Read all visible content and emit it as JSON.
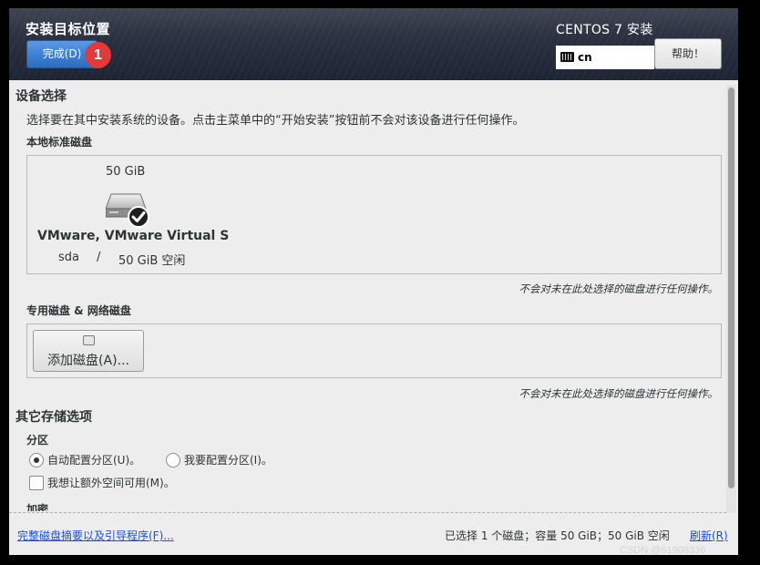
{
  "header": {
    "title": "安装目标位置",
    "done_label": "完成(D)",
    "badge": "1",
    "product": "CENTOS 7 安装",
    "keyboard_layout": "cn",
    "help_label": "帮助！"
  },
  "device_selection": {
    "title": "设备选择",
    "description": "选择要在其中安装系统的设备。点击主菜单中的“开始安装”按钮前不会对该设备进行任何操作。",
    "local_disks": {
      "title": "本地标准磁盘",
      "disk": {
        "size": "50 GiB",
        "name": "VMware, VMware Virtual S",
        "device": "sda",
        "separator": "/",
        "free": "50 GiB 空闲"
      },
      "note": "不会对未在此处选择的磁盘进行任何操作。"
    },
    "specialized_disks": {
      "title": "专用磁盘 & 网络磁盘",
      "add_label": "添加磁盘(A)...",
      "note": "不会对未在此处选择的磁盘进行任何操作。"
    }
  },
  "other_storage": {
    "title": "其它存储选项",
    "partition_title": "分区",
    "auto_partition": "自动配置分区(U)。",
    "manual_partition": "我要配置分区(I)。",
    "extra_space": "我想让额外空间可用(M)。",
    "encryption_title": "加密"
  },
  "footer": {
    "summary_link": "完整磁盘摘要以及引导程序(F)...",
    "status": "已选择 1 个磁盘；容量 50 GiB；50 GiB 空闲",
    "refresh_link": "刷新(R)"
  },
  "watermark": "CSDN @61908336"
}
